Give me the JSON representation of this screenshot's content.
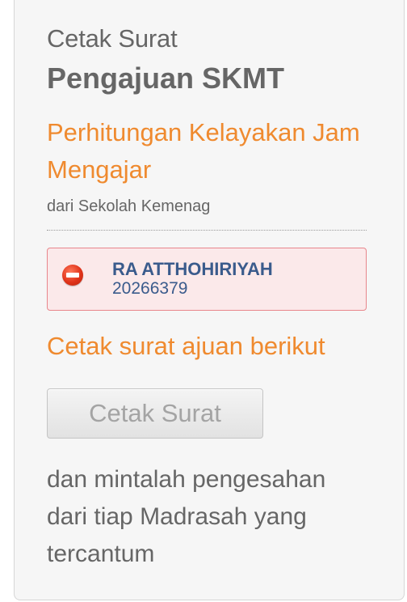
{
  "header": {
    "pre_title": "Cetak Surat",
    "title": "Pengajuan SKMT",
    "subtitle": "Perhitungan Kelayakan Jam Mengajar",
    "source": "dari Sekolah Kemenag"
  },
  "school": {
    "icon": "no-entry-icon",
    "name": "RA ATTHOHIRIYAH",
    "code": "20266379"
  },
  "instruction": "Cetak surat ajuan berikut",
  "print_button": {
    "label": "Cetak Surat",
    "enabled": false
  },
  "note": "dan mintalah pengesahan dari tiap Madrasah yang tercantum",
  "colors": {
    "accent": "#ef8a2f",
    "text": "#666666",
    "school_text": "#3a5b8c",
    "alert_bg": "#fbe9ea",
    "alert_border": "#e8868c",
    "alert_icon": "#e0331a"
  }
}
